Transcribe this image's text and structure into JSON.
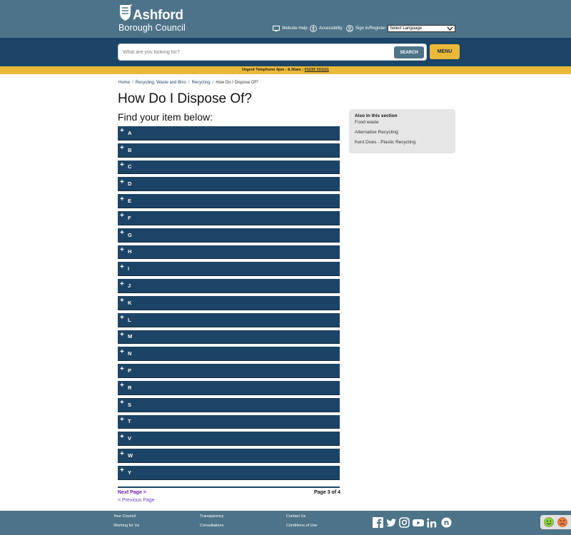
{
  "header": {
    "logo_name": "Ashford",
    "logo_sub": "Borough Council",
    "utility": [
      {
        "label": "Website Help",
        "icon": "monitor-icon"
      },
      {
        "label": "Accessibility",
        "icon": "accessibility-icon"
      },
      {
        "label": "Sign in/Register",
        "icon": "user-icon"
      }
    ],
    "language_select": "Select Language"
  },
  "search": {
    "placeholder": "What are you looking for?",
    "button_label": "SEARCH",
    "menu_label": "MENU"
  },
  "urgent": {
    "text": "Urgent Telephone 4pm - 8.30am : ",
    "phone": "01233 331111"
  },
  "breadcrumb": {
    "items": [
      "Home",
      "Recycling, Waste and Bins",
      "Recycling"
    ],
    "current": "How Do I Dispose Of?"
  },
  "main": {
    "title": "How Do I Dispose Of?",
    "subtitle": "Find your item below:",
    "accordion": [
      "A",
      "B",
      "C",
      "D",
      "E",
      "F",
      "G",
      "H",
      "I",
      "J",
      "K",
      "L",
      "M",
      "N",
      "P",
      "R",
      "S",
      "T",
      "V",
      "W",
      "Y"
    ]
  },
  "sidebar": {
    "title": "Also in this section",
    "links": [
      "Food waste",
      "Alternative Recycling",
      "Kent Does - Plastic Recycling"
    ]
  },
  "pager": {
    "next": "Next Page >",
    "prev": "< Previous Page",
    "count": "Page 3 of 4"
  },
  "footer": {
    "links": [
      "Your Council",
      "Working for Us",
      "Transparency",
      "Consultations",
      "Contact Us",
      "Conditions of Use"
    ],
    "social": [
      "facebook-icon",
      "twitter-icon",
      "instagram-icon",
      "youtube-icon",
      "linkedin-icon",
      "nextdoor-icon"
    ]
  },
  "colors": {
    "header_bg": "#4d7388",
    "navy": "#1c4466",
    "accent_yellow": "#eab93a"
  }
}
